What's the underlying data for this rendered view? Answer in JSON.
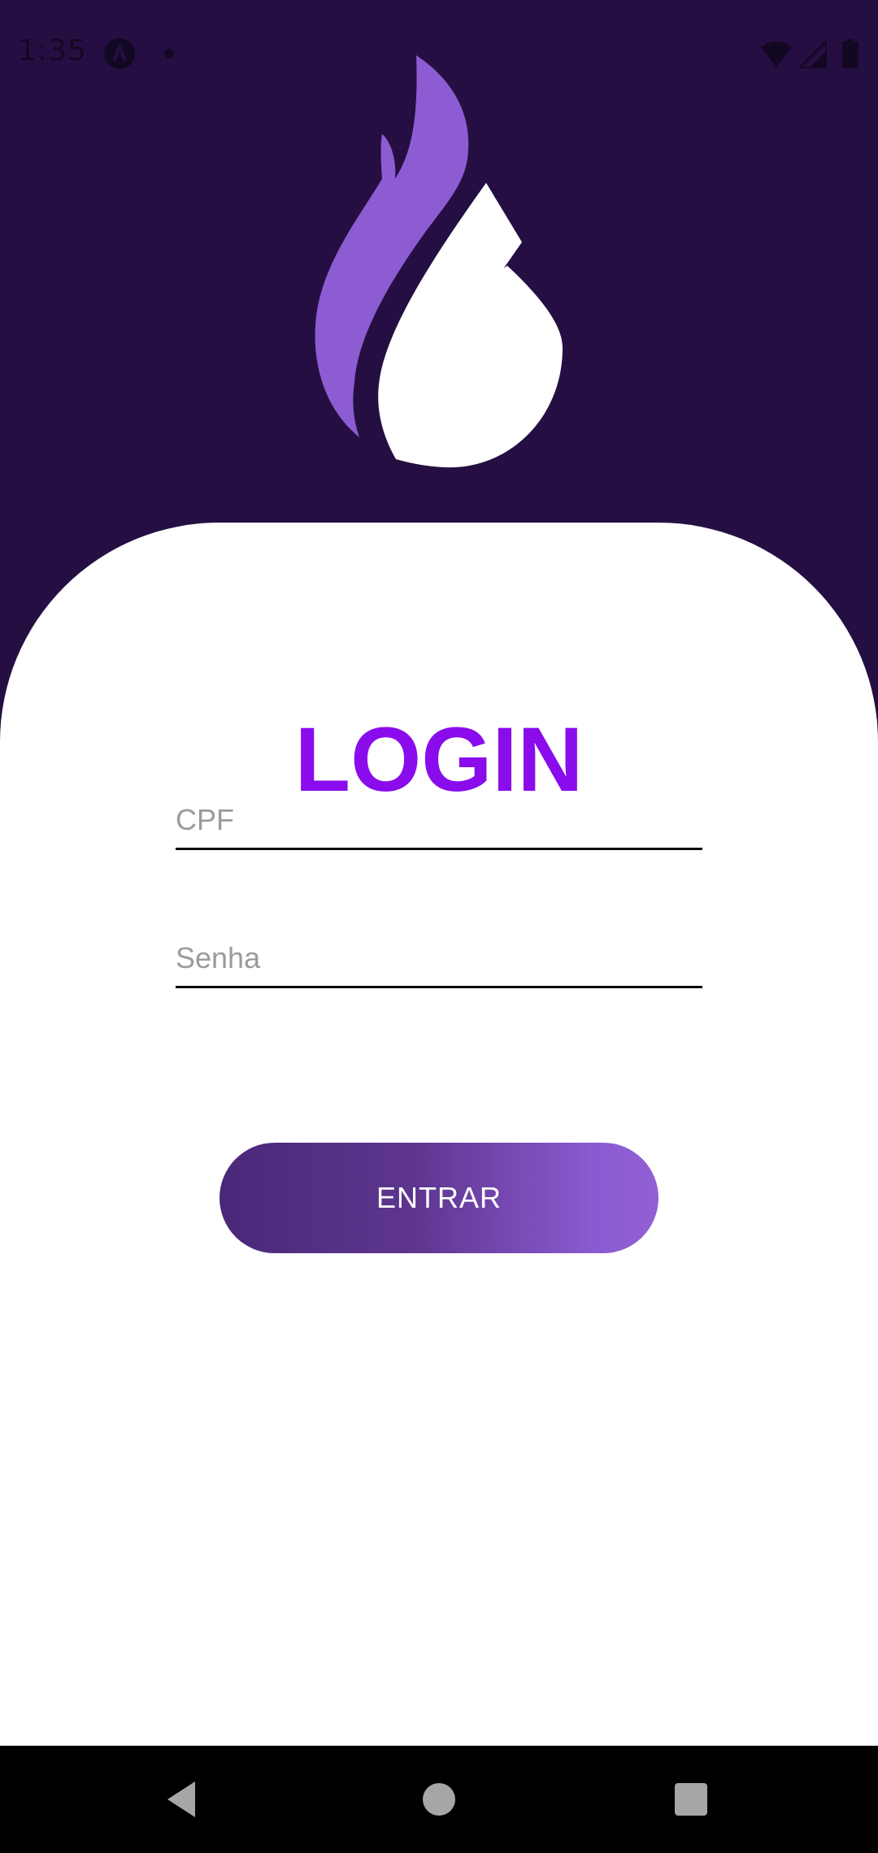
{
  "status_bar": {
    "time": "1:35",
    "icons": [
      "app-notification-icon",
      "dot-icon",
      "wifi-icon",
      "signal-icon",
      "battery-icon"
    ]
  },
  "logo": {
    "icon": "flame-drop-logo-icon",
    "colors": {
      "flame": "#8d5cd2",
      "drop": "#ffffff"
    }
  },
  "login": {
    "title": "LOGIN",
    "cpf_placeholder": "CPF",
    "cpf_value": "",
    "password_placeholder": "Senha",
    "password_value": "",
    "submit_label": "ENTRAR"
  },
  "navigation_bar": {
    "icons": [
      "back-icon",
      "home-icon",
      "recents-icon"
    ]
  },
  "colors": {
    "header_background": "#250f42",
    "title": "#8a0cec",
    "button_gradient_start": "#4a2878",
    "button_gradient_end": "#9160d4",
    "placeholder": "#9b9b9b",
    "nav_background": "#000000"
  }
}
